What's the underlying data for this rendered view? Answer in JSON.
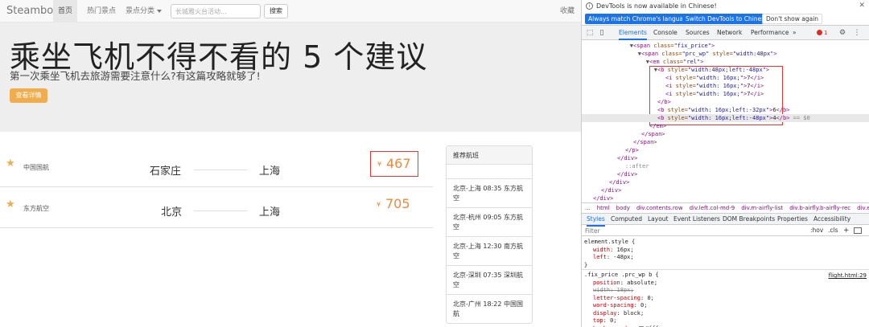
{
  "site": {
    "navbar": {
      "brand": "Steamboat",
      "items": [
        "首页",
        "热门景点",
        "景点分类"
      ],
      "search_placeholder": "长城雅火台活动...",
      "search_button": "搜索",
      "favorite": "收藏"
    },
    "hero": {
      "title": "乘坐飞机不得不看的 5 个建议",
      "subtitle": "第一次乘坐飞机去旅游需要注意什么?有这篇攻略就够了!",
      "button": "查看详情"
    },
    "flights": [
      {
        "airline": "中国国航",
        "from": "石家庄",
        "to": "上海",
        "currency": "¥",
        "price": "467",
        "highlighted": true
      },
      {
        "airline": "东方航空",
        "from": "北京",
        "to": "上海",
        "currency": "¥",
        "price": "705",
        "highlighted": false
      }
    ],
    "recommend": {
      "title": "推荐航班",
      "items": [
        "北京-上海 08:35 东方航空",
        "北京-杭州 09:05 东方航空",
        "北京-上海 12:30 南方航空",
        "北京-深圳 07:35 深圳航空",
        "北京-广州 18:22 中国国航"
      ]
    },
    "colors": {
      "accent": "#f0ad4e",
      "price": "#f0883a",
      "highlight_box": "#ee3333"
    }
  },
  "devtools": {
    "info_bar": {
      "text": "DevTools is now available in Chinese!",
      "buttons": [
        "Always match Chrome's language",
        "Switch DevTools to Chinese",
        "Don't show again"
      ]
    },
    "tabs": [
      "Elements",
      "Console",
      "Sources",
      "Network",
      "Performance",
      "»"
    ],
    "error_count": "1",
    "dom_lines": [
      {
        "indent": 64,
        "parts": [
          [
            "tag",
            "<span "
          ],
          [
            "attr",
            "class="
          ],
          [
            "val",
            "\"fix_price\""
          ],
          [
            "tag",
            ">"
          ]
        ],
        "arrow": "▼"
      },
      {
        "indent": 74,
        "parts": [
          [
            "tag",
            "<span "
          ],
          [
            "attr",
            "class="
          ],
          [
            "val",
            "\"prc_wp\" "
          ],
          [
            "attr",
            "style="
          ],
          [
            "val",
            "\"width:48px\""
          ],
          [
            "tag",
            ">"
          ]
        ],
        "arrow": "▼"
      },
      {
        "indent": 84,
        "parts": [
          [
            "tag",
            "<em "
          ],
          [
            "attr",
            "class="
          ],
          [
            "val",
            "\"rel\""
          ],
          [
            "tag",
            ">"
          ]
        ],
        "arrow": "▼"
      },
      {
        "indent": 94,
        "parts": [
          [
            "tag",
            "<b "
          ],
          [
            "attr",
            "style="
          ],
          [
            "val",
            "\"width:48px;left:-48px\""
          ],
          [
            "tag",
            ">"
          ]
        ],
        "arrow": "▼"
      },
      {
        "indent": 104,
        "parts": [
          [
            "tag",
            "<i "
          ],
          [
            "attr",
            "style="
          ],
          [
            "val",
            "\"width: 16px;\""
          ],
          [
            "tag",
            ">"
          ],
          [
            "txt",
            "7"
          ],
          [
            "tag",
            "</i>"
          ]
        ],
        "arrow": ""
      },
      {
        "indent": 104,
        "parts": [
          [
            "tag",
            "<i "
          ],
          [
            "attr",
            "style="
          ],
          [
            "val",
            "\"width: 16px;\""
          ],
          [
            "tag",
            ">"
          ],
          [
            "txt",
            "7"
          ],
          [
            "tag",
            "</i>"
          ]
        ],
        "arrow": ""
      },
      {
        "indent": 104,
        "parts": [
          [
            "tag",
            "<i "
          ],
          [
            "attr",
            "style="
          ],
          [
            "val",
            "\"width: 16px;\""
          ],
          [
            "tag",
            ">"
          ],
          [
            "txt",
            "7"
          ],
          [
            "tag",
            "</i>"
          ]
        ],
        "arrow": ""
      },
      {
        "indent": 94,
        "parts": [
          [
            "tag",
            "</b>"
          ]
        ],
        "arrow": ""
      },
      {
        "indent": 94,
        "parts": [
          [
            "tag",
            "<b "
          ],
          [
            "attr",
            "style="
          ],
          [
            "val",
            "\"width: 16px;left:-32px\""
          ],
          [
            "tag",
            ">"
          ],
          [
            "txt",
            "6"
          ],
          [
            "tag",
            "</b>"
          ]
        ],
        "arrow": ""
      },
      {
        "indent": 94,
        "parts": [
          [
            "tag",
            "<b "
          ],
          [
            "attr",
            "style="
          ],
          [
            "val",
            "\"width: 16px;left:-48px\""
          ],
          [
            "tag",
            ">"
          ],
          [
            "txt",
            "4"
          ],
          [
            "tag",
            "</b>"
          ],
          [
            "dim",
            " == $0"
          ]
        ],
        "arrow": "",
        "highlight": true
      },
      {
        "indent": 84,
        "parts": [
          [
            "tag",
            "</em>"
          ]
        ],
        "arrow": ""
      },
      {
        "indent": 74,
        "parts": [
          [
            "tag",
            "</span>"
          ]
        ],
        "arrow": ""
      },
      {
        "indent": 64,
        "parts": [
          [
            "tag",
            "</span>"
          ]
        ],
        "arrow": ""
      },
      {
        "indent": 54,
        "parts": [
          [
            "tag",
            "</p>"
          ]
        ],
        "arrow": ""
      },
      {
        "indent": 44,
        "parts": [
          [
            "tag",
            "</div>"
          ]
        ],
        "arrow": ""
      },
      {
        "indent": 54,
        "parts": [
          [
            "pseudo",
            "::after"
          ]
        ],
        "arrow": ""
      },
      {
        "indent": 44,
        "parts": [
          [
            "tag",
            "</div>"
          ]
        ],
        "arrow": ""
      },
      {
        "indent": 34,
        "parts": [
          [
            "tag",
            "</div>"
          ]
        ],
        "arrow": ""
      },
      {
        "indent": 24,
        "parts": [
          [
            "tag",
            "</div>"
          ]
        ],
        "arrow": ""
      },
      {
        "indent": 14,
        "parts": [
          [
            "tag",
            "</div>"
          ]
        ],
        "arrow": ""
      }
    ],
    "breadcrumbs": [
      "...",
      "html",
      "body",
      "div.contents.row",
      "div.left.col-md-9",
      "div.m-airfly-list",
      "div.b-airfly.b-airfly-rec",
      "div.e-a"
    ],
    "subtabs": [
      "Styles",
      "Computed",
      "Layout",
      "Event Listeners",
      "DOM Breakpoints",
      "Properties",
      "Accessibility"
    ],
    "filter_placeholder": "Filter",
    "filter_tools": [
      ":hov",
      ".cls",
      "+"
    ],
    "styles": {
      "element_style": {
        "selector": "element.style {",
        "props": [
          [
            "width",
            "16px;"
          ],
          [
            "left",
            "-48px;"
          ]
        ],
        "close": "}"
      },
      "rule": {
        "selector": ".fix_price .prc_wp b {",
        "source": "flight.html:29",
        "props": [
          [
            "position",
            "absolute;",
            false
          ],
          [
            "width",
            "18px;",
            true
          ],
          [
            "letter-spacing",
            "0;",
            false
          ],
          [
            "word-spacing",
            "0;",
            false
          ],
          [
            "display",
            "block;",
            false
          ],
          [
            "top",
            "0;",
            false
          ],
          [
            "background",
            "#fff;",
            false
          ]
        ]
      }
    }
  }
}
